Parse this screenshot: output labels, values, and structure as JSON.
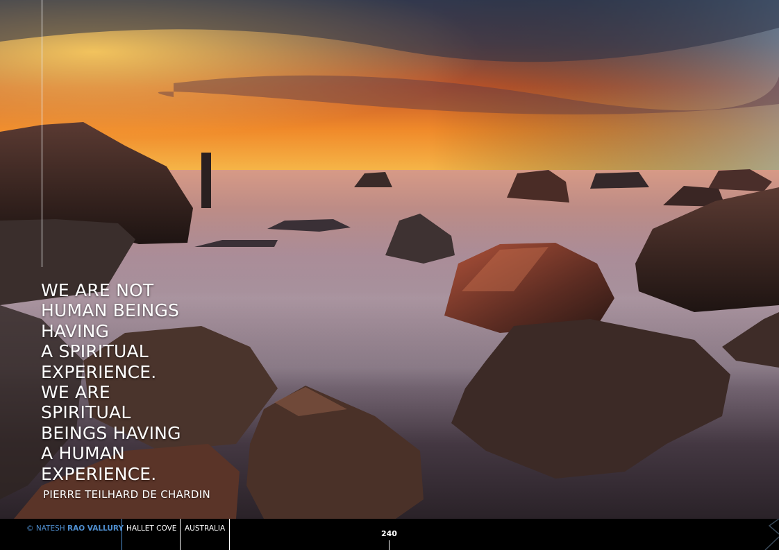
{
  "quote": {
    "lines": [
      "WE ARE NOT",
      "HUMAN BEINGS",
      "HAVING",
      "A SPIRITUAL",
      "EXPERIENCE.",
      "WE ARE",
      "SPIRITUAL",
      "BEINGS HAVING",
      "A HUMAN",
      "EXPERIENCE."
    ],
    "author": "PIERRE TEILHARD DE CHARDIN"
  },
  "footer": {
    "credit_prefix": "© NATESH",
    "credit_name": "RAO VALLURY",
    "location": "HALLET COVE",
    "country": "AUSTRALIA",
    "page_number": "240"
  },
  "colors": {
    "accent": "#4f8fd0",
    "footer_bg": "#000000",
    "text": "#ffffff"
  }
}
